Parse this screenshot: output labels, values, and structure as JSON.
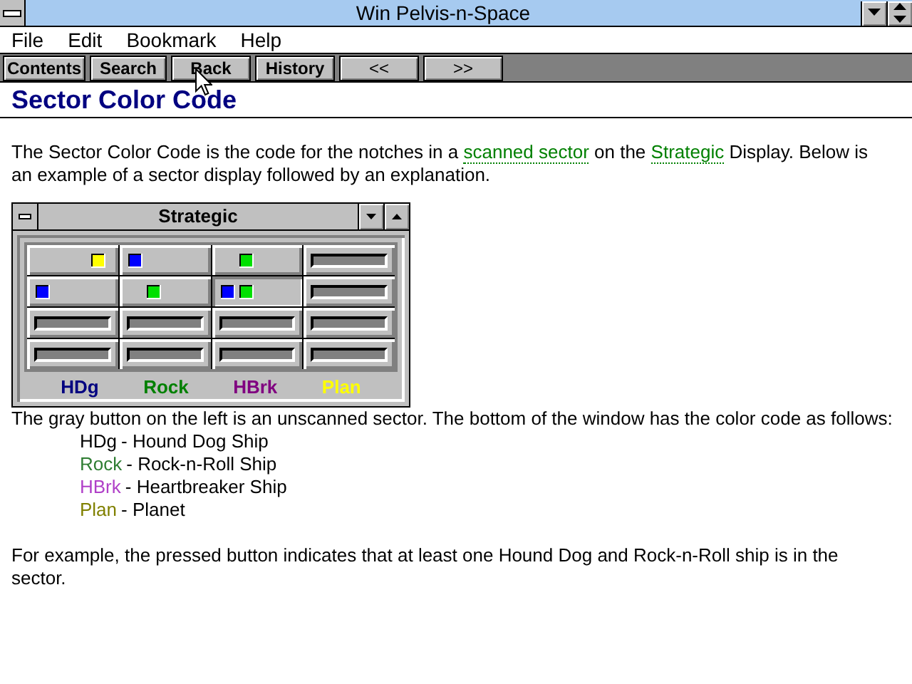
{
  "window": {
    "title": "Win Pelvis-n-Space"
  },
  "menu": [
    {
      "label": "File"
    },
    {
      "label": "Edit"
    },
    {
      "label": "Bookmark"
    },
    {
      "label": "Help"
    }
  ],
  "toolbar": [
    {
      "label": "Contents"
    },
    {
      "label": "Search"
    },
    {
      "label": "Back"
    },
    {
      "label": "History"
    },
    {
      "label": "<<"
    },
    {
      "label": ">>"
    }
  ],
  "heading": "Sector Color Code",
  "intro": [
    {
      "kind": "text",
      "text": "The Sector Color Code is the code for the notches in a "
    },
    {
      "kind": "link",
      "text": "scanned sector"
    },
    {
      "kind": "text",
      "text": " on the "
    },
    {
      "kind": "link",
      "text": "Strategic"
    },
    {
      "kind": "text",
      "text": " Display.  Below is an example of a sector display followed by an explanation."
    }
  ],
  "strategic": {
    "title": "Strategic",
    "rows": [
      [
        {
          "kind": "scanned",
          "pressed": false,
          "markers": [
            {
              "kind": "planet",
              "color": "#ffff00"
            }
          ]
        },
        {
          "kind": "scanned",
          "pressed": false,
          "markers": [
            {
              "kind": "houndDog",
              "color": "#0000ff"
            }
          ]
        },
        {
          "kind": "scanned",
          "pressed": false,
          "markers": [
            {
              "kind": "rock",
              "color": "#00e000"
            }
          ]
        },
        {
          "kind": "unscanned",
          "pressed": false
        }
      ],
      [
        {
          "kind": "scanned",
          "pressed": false,
          "markers": [
            {
              "kind": "houndDog",
              "color": "#0000ff"
            }
          ]
        },
        {
          "kind": "scanned",
          "pressed": false,
          "markers": [
            {
              "kind": "rock",
              "color": "#00e000"
            }
          ]
        },
        {
          "kind": "scanned",
          "pressed": true,
          "markers": [
            {
              "kind": "houndDog",
              "color": "#0000ff"
            },
            {
              "kind": "rock",
              "color": "#00e000"
            }
          ]
        },
        {
          "kind": "unscanned",
          "pressed": false
        }
      ],
      [
        {
          "kind": "unscanned",
          "pressed": false
        },
        {
          "kind": "unscanned",
          "pressed": false
        },
        {
          "kind": "unscanned",
          "pressed": false
        },
        {
          "kind": "unscanned",
          "pressed": false
        }
      ],
      [
        {
          "kind": "unscanned",
          "pressed": false
        },
        {
          "kind": "unscanned",
          "pressed": false
        },
        {
          "kind": "unscanned",
          "pressed": false
        },
        {
          "kind": "unscanned",
          "pressed": false
        }
      ]
    ],
    "legend": [
      {
        "label": "HDg",
        "color": "#000080"
      },
      {
        "label": "Rock",
        "color": "#008000"
      },
      {
        "label": "HBrk",
        "color": "#800080"
      },
      {
        "label": "Plan",
        "color": "#ffff00"
      }
    ]
  },
  "explanation": "The gray button on the left is an unscanned sector.  The bottom of the window has the color code as follows:",
  "codes": [
    {
      "code": "HDg",
      "color": "#000000",
      "meaning": "- Hound Dog Ship"
    },
    {
      "code": "Rock",
      "color": "#2e7d32",
      "meaning": "- Rock-n-Roll Ship"
    },
    {
      "code": "HBrk",
      "color": "#b040c8",
      "meaning": "- Heartbreaker Ship"
    },
    {
      "code": "Plan",
      "color": "#808000",
      "meaning": "- Planet"
    }
  ],
  "example": "For example, the pressed button indicates that at least one Hound Dog and Rock-n-Roll ship is in the sector."
}
